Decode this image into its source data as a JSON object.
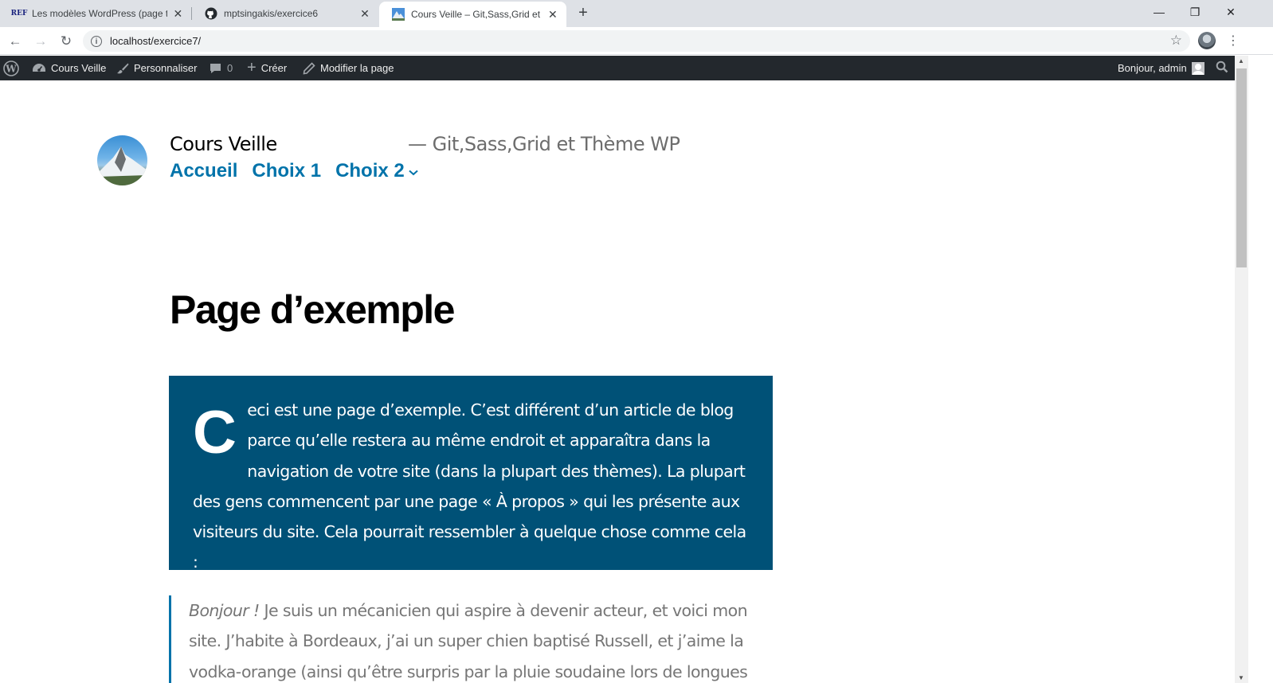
{
  "browser": {
    "tabs": [
      {
        "favicon": "ref-icon",
        "title": "Les modèles WordPress (page te",
        "active": false
      },
      {
        "favicon": "github-icon",
        "title": "mptsingakis/exercice6",
        "active": false
      },
      {
        "favicon": "mountain-icon",
        "title": "Cours Veille – Git,Sass,Grid et The",
        "active": true
      }
    ],
    "favicon_labels": {
      "ref": "REF"
    },
    "url": "localhost/exercice7/",
    "colors": {
      "tabstrip": "#dee1e6",
      "active_tab": "#ffffff"
    }
  },
  "adminbar": {
    "site_name": "Cours Veille",
    "customize": "Personnaliser",
    "comments_count": "0",
    "new": "Créer",
    "edit": "Modifier la page",
    "greeting": "Bonjour, admin",
    "colors": {
      "background": "#23282d"
    }
  },
  "site": {
    "title": "Cours Veille",
    "description": "— Git,Sass,Grid et Thème WP",
    "menu": [
      "Accueil",
      "Choix 1",
      "Choix 2"
    ]
  },
  "page": {
    "title": "Page d’exemple",
    "dropcap": "C",
    "cover_text": "eci est une page d’exemple. C’est différent d’un article de blog parce qu’elle restera au même endroit et apparaîtra dans la navigation de votre site (dans la plupart des thèmes). La plupart des gens commencent par une page « À propos » qui les présente aux visiteurs du site. Cela pourrait ressembler à quelque chose comme cela :",
    "quote_em": "Bonjour !",
    "quote_text": " Je suis un mécanicien qui aspire à devenir acteur, et voici mon site. J’habite à Bordeaux, j’ai un super chien baptisé Russell, et j’aime la vodka-orange (ainsi qu’être surpris par la pluie soudaine lors de longues balades",
    "colors": {
      "cover_bg": "#005177",
      "link": "#0073aa",
      "quote_text": "#767676"
    }
  }
}
